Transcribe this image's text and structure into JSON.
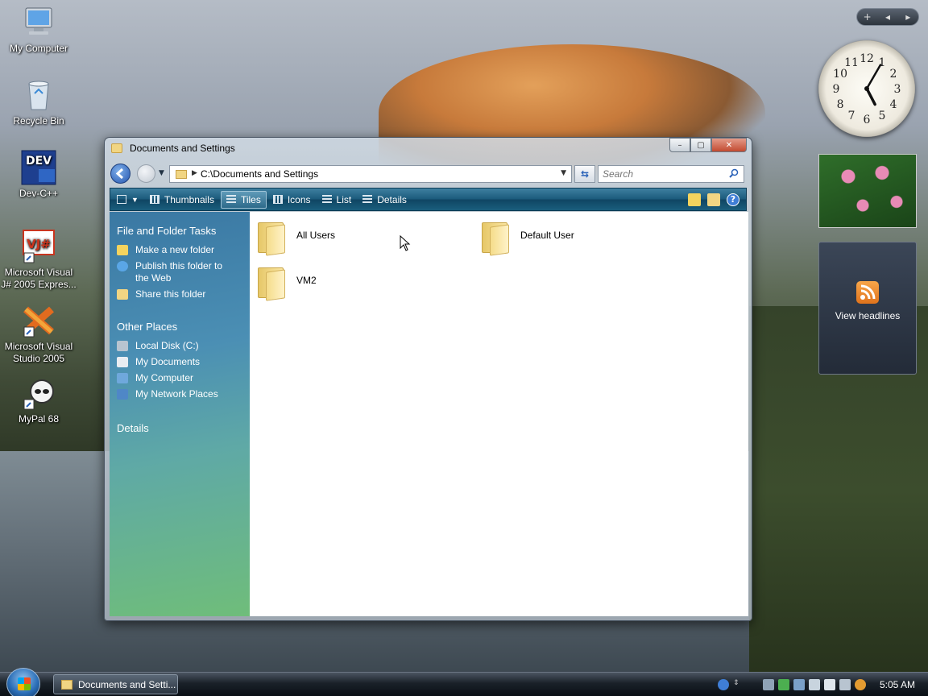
{
  "desktop": {
    "icons": [
      {
        "label": "My Computer"
      },
      {
        "label": "Recycle Bin"
      },
      {
        "label": "Dev-C++",
        "badge": "DEV"
      },
      {
        "label": "Microsoft Visual J# 2005 Expres...",
        "badge": "VJ#"
      },
      {
        "label": "Microsoft Visual Studio 2005"
      },
      {
        "label": "MyPal 68"
      }
    ]
  },
  "gadgets": {
    "bar_add": "+",
    "bar_prev": "◂",
    "bar_next": "▸",
    "clock_numbers": [
      "12",
      "1",
      "2",
      "3",
      "4",
      "5",
      "6",
      "7",
      "8",
      "9",
      "10",
      "11"
    ],
    "clock_time": {
      "hour": 5,
      "minute": 5
    },
    "feed_label": "View headlines"
  },
  "window": {
    "title": "Documents and Settings",
    "buttons": {
      "minimize": "–",
      "maximize": "▢",
      "close": "✕"
    },
    "address": "C:\\Documents and Settings",
    "search_placeholder": "Search",
    "toolbar": {
      "views": [
        {
          "label": "Thumbnails",
          "icon": "thumbnails-icon",
          "active": false
        },
        {
          "label": "Tiles",
          "icon": "tiles-icon",
          "active": true
        },
        {
          "label": "Icons",
          "icon": "icons-icon",
          "active": false
        },
        {
          "label": "List",
          "icon": "list-icon",
          "active": false
        },
        {
          "label": "Details",
          "icon": "details-icon",
          "active": false
        }
      ],
      "help": "?"
    },
    "sidepane": {
      "tasks_heading": "File and Folder Tasks",
      "tasks": [
        {
          "label": "Make a new folder",
          "color": "#f4d35e"
        },
        {
          "label": "Publish this folder to the Web",
          "color": "#5aa6e6"
        },
        {
          "label": "Share this folder",
          "color": "#f1d583"
        }
      ],
      "places_heading": "Other Places",
      "places": [
        {
          "label": "Local Disk (C:)",
          "color": "#b8c4d0"
        },
        {
          "label": "My Documents",
          "color": "#e9edf2"
        },
        {
          "label": "My Computer",
          "color": "#6fa8dc"
        },
        {
          "label": "My Network Places",
          "color": "#4f87c7"
        }
      ],
      "details_heading": "Details"
    },
    "items": [
      {
        "name": "All Users"
      },
      {
        "name": "Default User"
      },
      {
        "name": "VM2"
      }
    ]
  },
  "taskbar": {
    "task_label": "Documents and Setti...",
    "time": "5:05 AM"
  }
}
